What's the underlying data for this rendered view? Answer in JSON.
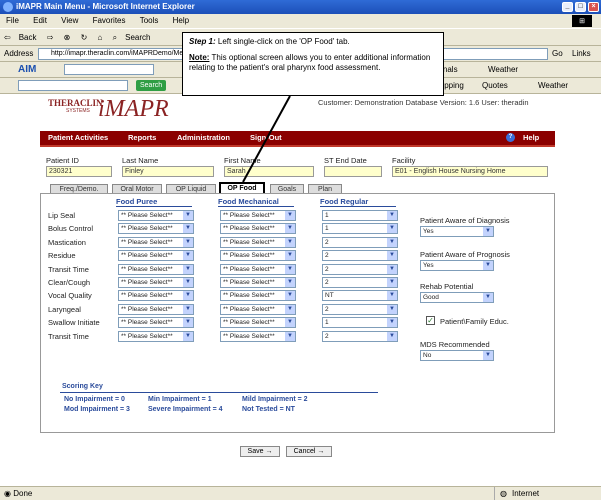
{
  "window": {
    "title": "iMAPR Main Menu - Microsoft Internet Explorer"
  },
  "menu": [
    "File",
    "Edit",
    "View",
    "Favorites",
    "Tools",
    "Help"
  ],
  "toolbar": {
    "back": "Back",
    "search": "Search"
  },
  "address": {
    "label": "Address",
    "url": "http://imapr.theraclin.com/iMAPRDemo/Me",
    "go": "Go",
    "links": "Links"
  },
  "aim": {
    "label": "AIM",
    "personals": "Personals",
    "weather": "Weather"
  },
  "searchrow": {
    "search_btn": "Search",
    "shopping": "Shopping",
    "quotes": "Quotes",
    "weather": "Weather"
  },
  "callout": {
    "step": "Step 1:",
    "step_text": "Left single-click on the 'OP Food' tab.",
    "note": "Note:",
    "note_text": "This optional screen allows you to enter additional information relating to the patient's oral pharynx food assessment."
  },
  "app": {
    "brand": "THERACLIN",
    "brand_sub": "SYSTEMS",
    "title": "iMAPR",
    "customer": "Customer: Demonstration Database Version: 1.6 User: theradin",
    "nav": [
      "Patient Activities",
      "Reports",
      "Administration",
      "Sign-Out"
    ],
    "help": "Help"
  },
  "patient": {
    "id_label": "Patient ID",
    "id": "230321",
    "last_label": "Last Name",
    "last": "Finley",
    "first_label": "First Name",
    "first": "Sarah",
    "st_label": "ST End Date",
    "st": "",
    "facility_label": "Facility",
    "facility": "E01 - English House Nursing Home"
  },
  "tabs": [
    "Freq./Demo.",
    "Oral Motor",
    "OP Liquid",
    "OP Food",
    "Goals",
    "Plan"
  ],
  "columns": [
    "Food Puree",
    "Food Mechanical",
    "Food Regular"
  ],
  "rows": [
    {
      "label": "Lip Seal",
      "puree": "** Please Select**",
      "mech": "** Please Select**",
      "reg": "1"
    },
    {
      "label": "Bolus Control",
      "puree": "** Please Select**",
      "mech": "** Please Select**",
      "reg": "1"
    },
    {
      "label": "Mastication",
      "puree": "** Please Select**",
      "mech": "** Please Select**",
      "reg": "2"
    },
    {
      "label": "Residue",
      "puree": "** Please Select**",
      "mech": "** Please Select**",
      "reg": "2"
    },
    {
      "label": "Transit Time",
      "puree": "** Please Select**",
      "mech": "** Please Select**",
      "reg": "2"
    },
    {
      "label": "Clear/Cough",
      "puree": "** Please Select**",
      "mech": "** Please Select**",
      "reg": "2"
    },
    {
      "label": "Vocal Quality",
      "puree": "** Please Select**",
      "mech": "** Please Select**",
      "reg": "NT"
    },
    {
      "label": "Laryngeal",
      "puree": "** Please Select**",
      "mech": "** Please Select**",
      "reg": "2"
    },
    {
      "label": "Swallow Initiate",
      "puree": "** Please Select**",
      "mech": "** Please Select**",
      "reg": "1"
    },
    {
      "label": "Transit Time",
      "puree": "** Please Select**",
      "mech": "** Please Select**",
      "reg": "2"
    }
  ],
  "right": {
    "aware_dx_label": "Patient Aware of Diagnosis",
    "aware_dx": "Yes",
    "aware_px_label": "Patient Aware of Prognosis",
    "aware_px": "Yes",
    "rehab_label": "Rehab Potential",
    "rehab": "Good",
    "edu_label": "Patient\\Family Educ.",
    "mds_label": "MDS Recommended",
    "mds": "No"
  },
  "scoring": {
    "title": "Scoring Key",
    "l1a": "No Impairment = 0",
    "l1b": "Min Impairment = 1",
    "l1c": "Mild Impairment = 2",
    "l2a": "Mod Impairment = 3",
    "l2b": "Severe Impairment = 4",
    "l2c": "Not Tested = NT"
  },
  "buttons": {
    "save": "Save",
    "cancel": "Cancel"
  },
  "status": {
    "left": "Done",
    "right": "Internet"
  }
}
